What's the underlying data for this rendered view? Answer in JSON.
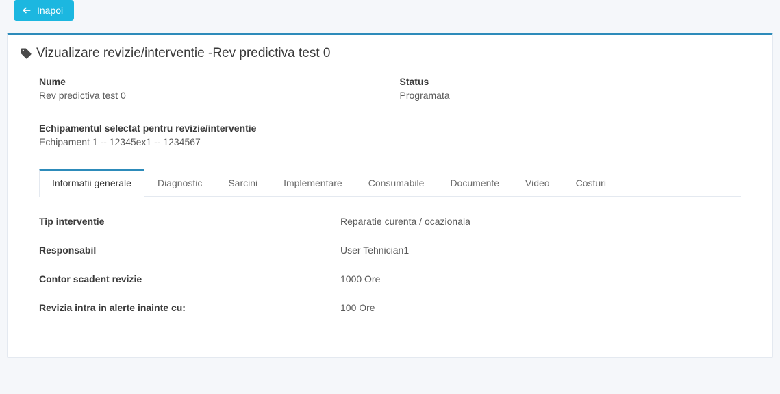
{
  "back_button": {
    "label": "Inapoi"
  },
  "panel": {
    "title_prefix": "Vizualizare revizie/interventie - ",
    "title_name": "Rev predictiva test 0"
  },
  "summary": {
    "fields": {
      "name_label": "Nume",
      "name_value": "Rev predictiva test 0",
      "status_label": "Status",
      "status_value": "Programata",
      "equipment_label": "Echipamentul selectat pentru revizie/interventie",
      "equipment_value": "Echipament 1 -- 12345ex1 -- 1234567"
    }
  },
  "tabs": [
    {
      "label": "Informatii generale",
      "active": true
    },
    {
      "label": "Diagnostic",
      "active": false
    },
    {
      "label": "Sarcini",
      "active": false
    },
    {
      "label": "Implementare",
      "active": false
    },
    {
      "label": "Consumabile",
      "active": false
    },
    {
      "label": "Documente",
      "active": false
    },
    {
      "label": "Video",
      "active": false
    },
    {
      "label": "Costuri",
      "active": false
    }
  ],
  "general_info": {
    "rows": [
      {
        "label": "Tip interventie",
        "value": "Reparatie curenta / ocazionala"
      },
      {
        "label": "Responsabil",
        "value": "User Tehnician1"
      },
      {
        "label": "Contor scadent revizie",
        "value": "1000 Ore"
      },
      {
        "label": "Revizia intra in alerte inainte cu:",
        "value": "100 Ore"
      }
    ]
  }
}
